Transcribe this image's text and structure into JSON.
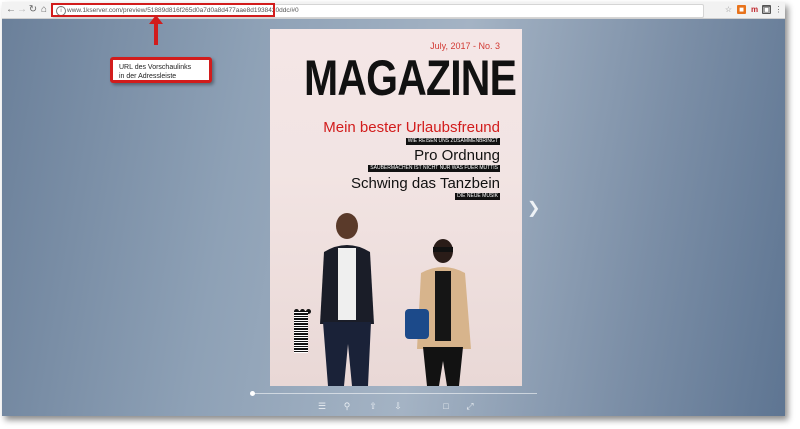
{
  "browser": {
    "address_url": "www.1kserver.com/preview/51889d816f265d0a7d0a8d477aae8d1938420ddc/#0",
    "icons": [
      "back-icon",
      "forward-icon",
      "reload-icon",
      "home-icon",
      "star-icon",
      "extension-icon",
      "menu-icon"
    ]
  },
  "annotation": {
    "callout_line1": "URL des Vorschaulinks",
    "callout_line2": "in der Adressleiste",
    "color": "#d21c1c"
  },
  "cover": {
    "issue": "July, 2017 - No. 3",
    "title": "MAGAZINE",
    "headlines": [
      {
        "text": "Mein bester Urlaubsfreund",
        "sub": "WIE REISEN UNS ZUSAMMENBRINGT"
      },
      {
        "text": "Pro Ordnung",
        "sub": "SAUBERMACHEN IST NICHT NUR WAS FUER MUTTIS"
      },
      {
        "text": "Schwing das Tanzbein",
        "sub": "DIE NEUE MUSIK"
      }
    ],
    "accent": "#d21c1c"
  },
  "viewer": {
    "progress": 0,
    "toolbar_icons": [
      "thumbnails-icon",
      "search-icon",
      "share-icon",
      "download-icon",
      "fit-icon",
      "fullscreen-icon"
    ]
  }
}
